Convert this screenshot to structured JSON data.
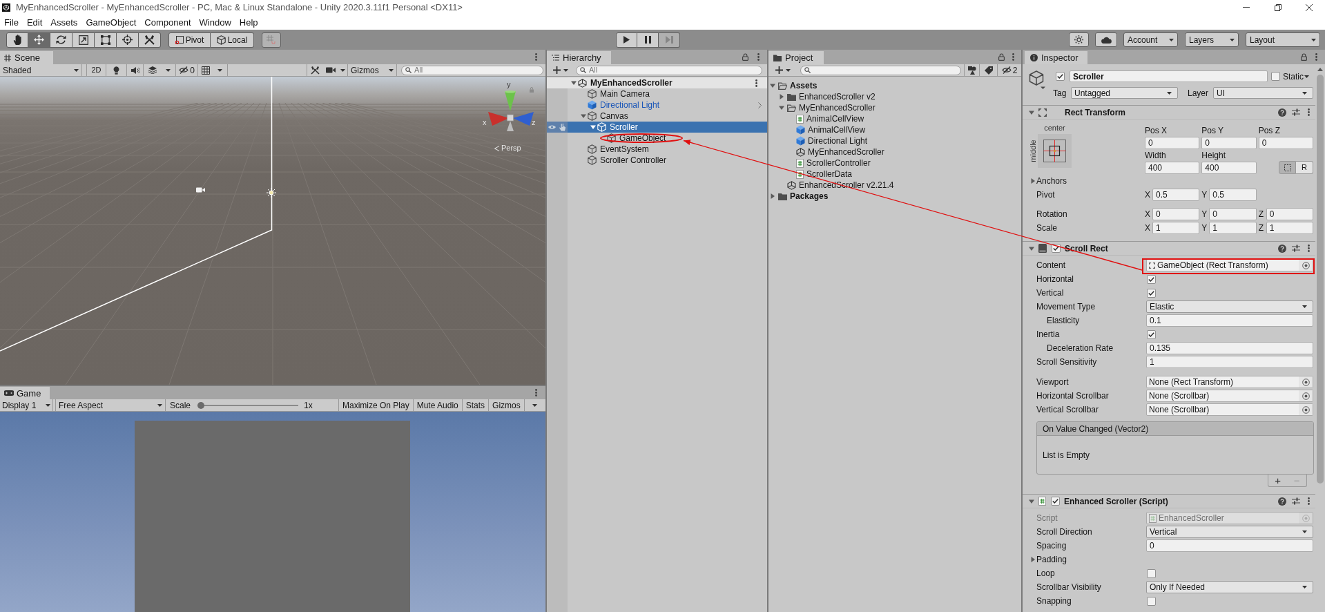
{
  "window": {
    "title": "MyEnhancedScroller - MyEnhancedScroller - PC, Mac & Linux Standalone - Unity 2020.3.11f1 Personal <DX11>"
  },
  "menu": [
    "File",
    "Edit",
    "Assets",
    "GameObject",
    "Component",
    "Window",
    "Help"
  ],
  "toolbar": {
    "tools": [
      {
        "kind": "hand",
        "selected": false
      },
      {
        "kind": "move",
        "selected": true
      },
      {
        "kind": "rotate",
        "selected": false
      },
      {
        "kind": "scale",
        "selected": false
      },
      {
        "kind": "rect",
        "selected": false
      },
      {
        "kind": "transform",
        "selected": false
      },
      {
        "kind": "custom",
        "selected": false
      }
    ],
    "pivot": "Pivot",
    "space": "Local",
    "snap": {
      "disabled": true
    },
    "playback": [
      {
        "kind": "play",
        "disabled": false
      },
      {
        "kind": "pause",
        "disabled": false
      },
      {
        "kind": "step",
        "disabled": true
      }
    ],
    "account": "Account",
    "layers": "Layers",
    "layout": "Layout"
  },
  "scene": {
    "tab": "Scene",
    "shading": "Shaded",
    "mode_2d": "2D",
    "hidden_count": "0",
    "gizmos": "Gizmos",
    "search": {
      "placeholder": "All"
    },
    "axes": [
      "y",
      "x",
      "z"
    ],
    "projection": "Persp"
  },
  "game": {
    "tab": "Game",
    "display": "Display 1",
    "aspect": "Free Aspect",
    "scale_label": "Scale",
    "scale_slider": {
      "level": 0
    },
    "scale_value": "1x",
    "toggles": [
      "Maximize On Play",
      "Mute Audio",
      "Stats"
    ],
    "gizmos": "Gizmos"
  },
  "hierarchy": {
    "tab": "Hierarchy",
    "search": {
      "placeholder": "All"
    },
    "scene": {
      "name": "MyEnhancedScroller",
      "expanded": true,
      "children": [
        {
          "name": "Main Camera",
          "kind": "object",
          "selected": false
        },
        {
          "name": "Directional Light",
          "kind": "prefab",
          "selected": false
        },
        {
          "name": "Canvas",
          "kind": "object",
          "selected": false,
          "expanded": true,
          "children": [
            {
              "name": "Scroller",
              "kind": "object",
              "selected": true,
              "expanded": true,
              "children": [
                {
                  "name": "GameObject",
                  "kind": "object",
                  "selected": false
                }
              ]
            }
          ]
        },
        {
          "name": "EventSystem",
          "kind": "object",
          "selected": false
        },
        {
          "name": "Scroller Controller",
          "kind": "object",
          "selected": false
        }
      ]
    }
  },
  "project": {
    "tab": "Project",
    "hidden_count": "2",
    "tree": [
      {
        "name": "Assets",
        "kind": "folder",
        "expanded": true,
        "selected": false,
        "children": [
          {
            "name": "EnhancedScroller v2",
            "kind": "folder",
            "expanded": false,
            "selected": false
          },
          {
            "name": "MyEnhancedScroller",
            "kind": "folder",
            "expanded": true,
            "selected": false,
            "children": [
              {
                "name": "AnimalCellView",
                "kind": "script",
                "selected": false
              },
              {
                "name": "AnimalCellView",
                "kind": "prefab",
                "selected": false
              },
              {
                "name": "Directional Light",
                "kind": "prefab",
                "selected": false
              },
              {
                "name": "MyEnhancedScroller",
                "kind": "scene",
                "selected": false
              },
              {
                "name": "ScrollerController",
                "kind": "script",
                "selected": false
              },
              {
                "name": "ScrollerData",
                "kind": "script",
                "selected": false
              }
            ]
          },
          {
            "name": "EnhancedScroller v2.21.4",
            "kind": "scene",
            "selected": false
          }
        ]
      },
      {
        "name": "Packages",
        "kind": "folder",
        "expanded": false,
        "selected": false
      }
    ]
  },
  "inspector": {
    "tab": "Inspector",
    "object": {
      "active": true,
      "name": "Scroller",
      "static": false,
      "static_label": "Static",
      "tag_label": "Tag",
      "tag": "Untagged",
      "layer_label": "Layer",
      "layer": "UI"
    },
    "rect_transform": {
      "title": "Rect Transform",
      "expanded": true,
      "anchor_h": "center",
      "anchor_v": "middle",
      "fields": [
        {
          "label": "Pos X",
          "value": "0"
        },
        {
          "label": "Pos Y",
          "value": "0"
        },
        {
          "label": "Pos Z",
          "value": "0"
        },
        {
          "label": "Width",
          "value": "400"
        },
        {
          "label": "Height",
          "value": "400"
        }
      ],
      "edit_modes": [
        {
          "kind": "blueprint",
          "selected": true
        },
        {
          "kind": "raw",
          "label": "R",
          "selected": false
        }
      ],
      "anchors": {
        "label": "Anchors",
        "expanded": false
      },
      "vector_groups": [
        [
          {
            "label": "Pivot",
            "axes": [
              {
                "axis": "X",
                "value": "0.5"
              },
              {
                "axis": "Y",
                "value": "0.5"
              }
            ]
          }
        ],
        [
          {
            "label": "Rotation",
            "axes": [
              {
                "axis": "X",
                "value": "0"
              },
              {
                "axis": "Y",
                "value": "0"
              },
              {
                "axis": "Z",
                "value": "0"
              }
            ]
          },
          {
            "label": "Scale",
            "axes": [
              {
                "axis": "X",
                "value": "1"
              },
              {
                "axis": "Y",
                "value": "1"
              },
              {
                "axis": "Z",
                "value": "1"
              }
            ]
          }
        ]
      ]
    },
    "components": [
      {
        "kind": "scroll_rect",
        "title": "Scroll Rect",
        "enabled": true,
        "expanded": true,
        "groups": [
          [
            {
              "label": "Content",
              "kind": "reference",
              "value": "GameObject (Rect Transform)"
            },
            {
              "label": "Horizontal",
              "kind": "toggle",
              "checked": true
            },
            {
              "label": "Vertical",
              "kind": "toggle",
              "checked": true
            },
            {
              "label": "Movement Type",
              "kind": "dropdown",
              "value": "Elastic",
              "children": [
                {
                  "label": "Elasticity",
                  "kind": "number",
                  "value": "0.1"
                }
              ]
            },
            {
              "label": "Inertia",
              "kind": "toggle",
              "checked": true,
              "children": [
                {
                  "label": "Deceleration Rate",
                  "kind": "number",
                  "value": "0.135"
                }
              ]
            },
            {
              "label": "Scroll Sensitivity",
              "kind": "number",
              "value": "1"
            }
          ],
          [
            {
              "label": "Viewport",
              "kind": "object",
              "value": "None (Rect Transform)"
            },
            {
              "label": "Horizontal Scrollbar",
              "kind": "object",
              "value": "None (Scrollbar)"
            },
            {
              "label": "Vertical Scrollbar",
              "kind": "object",
              "value": "None (Scrollbar)"
            }
          ]
        ],
        "event": {
          "title": "On Value Changed (Vector2)",
          "empty": "List is Empty",
          "buttons": [
            {
              "label": "+",
              "disabled": false
            },
            {
              "label": "−",
              "disabled": true
            }
          ]
        }
      },
      {
        "kind": "script",
        "title": "Enhanced Scroller (Script)",
        "enabled": true,
        "expanded": true,
        "groups": [
          [
            {
              "label": "Script",
              "kind": "script",
              "value": "EnhancedScroller"
            },
            {
              "label": "Scroll Direction",
              "kind": "dropdown",
              "value": "Vertical"
            },
            {
              "label": "Spacing",
              "kind": "number",
              "value": "0"
            },
            {
              "label": "Padding",
              "kind": "foldout",
              "expanded": false
            },
            {
              "label": "Loop",
              "kind": "toggle",
              "checked": false
            },
            {
              "label": "Scrollbar Visibility",
              "kind": "dropdown",
              "value": "Only If Needed"
            },
            {
              "label": "Snapping",
              "kind": "toggle",
              "checked": false
            }
          ]
        ]
      }
    ]
  }
}
